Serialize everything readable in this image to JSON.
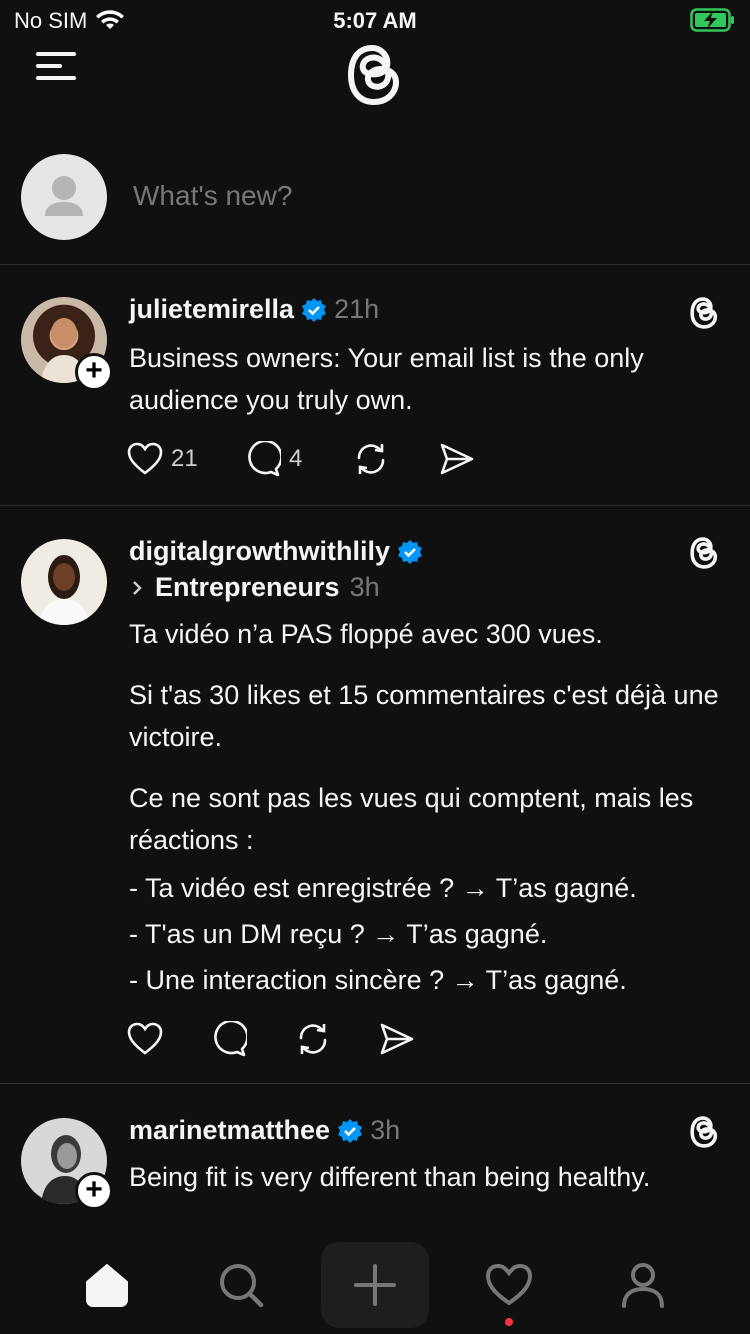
{
  "status": {
    "carrier": "No SIM",
    "time": "5:07 AM"
  },
  "composer": {
    "placeholder": "What's new?"
  },
  "posts": [
    {
      "username": "julietemirella",
      "verified": true,
      "time": "21h",
      "text": [
        "Business owners: Your email list is the only audience you truly own."
      ],
      "likes": "21",
      "replies": "4"
    },
    {
      "username": "digitalgrowthwithlily",
      "verified": true,
      "community": "Entrepreneurs",
      "time": "3h",
      "text": [
        "Ta vidéo n’a PAS floppé avec 300 vues.",
        "Si t'as 30 likes et 15 commentaires c'est déjà une victoire.",
        "Ce ne sont pas les vues qui comptent, mais les réactions :",
        "- Ta vidéo est enregistrée ? → T’as gagné.",
        "- T'as un DM reçu ? → T’as gagné.",
        "- Une interaction sincère ? → T’as gagné."
      ]
    },
    {
      "username": "marinetmatthee",
      "verified": true,
      "time": "3h",
      "text": [
        "Being fit is very different than being healthy."
      ]
    }
  ],
  "colors": {
    "background": "#101010",
    "verified": "#0095f6",
    "muted": "#77777a",
    "notification": "#ff3040"
  }
}
